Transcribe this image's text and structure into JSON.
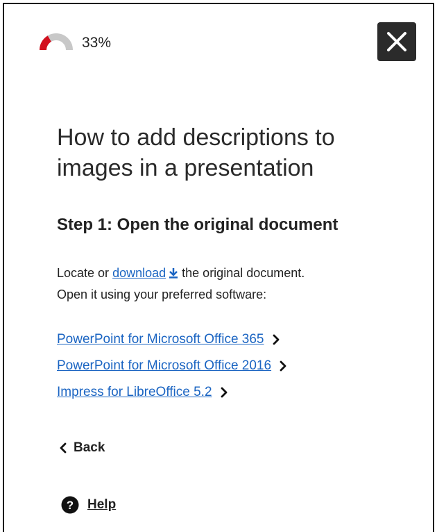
{
  "progress": {
    "percent_label": "33%",
    "value": 0.33,
    "fill_color": "#d2101e",
    "track_color": "#c8c8c8"
  },
  "close_button": {
    "icon": "close-icon",
    "background": "#2b2b2b"
  },
  "title": "How to add descriptions to images in a presentation",
  "step": {
    "heading": "Step 1: Open the original document",
    "line1_prefix": "Locate or",
    "download_link": "download",
    "download_icon": "download-icon",
    "line1_suffix": "the original document.",
    "line2": "Open it using your preferred software:"
  },
  "software_links": [
    {
      "label": "PowerPoint for Microsoft Office 365",
      "icon": "chevron-right-icon"
    },
    {
      "label": "PowerPoint for Microsoft Office 2016",
      "icon": "chevron-right-icon"
    },
    {
      "label": "Impress for LibreOffice 5.2",
      "icon": "chevron-right-icon"
    }
  ],
  "back": {
    "label": "Back",
    "icon": "chevron-left-icon"
  },
  "help": {
    "label": "Help",
    "icon": "question-circle-icon"
  },
  "colors": {
    "link": "#1a64c2",
    "text": "#222222"
  }
}
